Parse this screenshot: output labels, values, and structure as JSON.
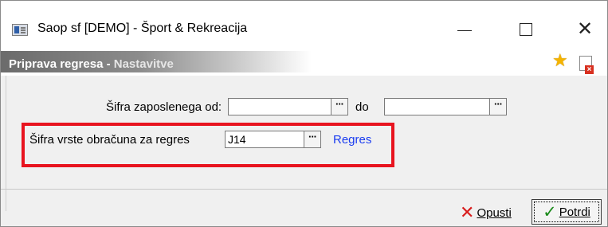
{
  "window": {
    "title": "Saop sf [DEMO] - Šport & Rekreacija",
    "minimize_icon": "minimize-icon",
    "maximize_icon": "maximize-icon",
    "close_icon": "close-icon",
    "close_glyph": "✕"
  },
  "header": {
    "title_main": "Priprava regresa - ",
    "title_sub": "Nastavitve",
    "favorite_icon": "star-icon",
    "favorite_glyph": "★",
    "doc_icon": "document-close-icon"
  },
  "form": {
    "employee_from_label": "Šifra zaposlenega od:",
    "employee_from_value": "",
    "employee_to_label": "do",
    "employee_to_value": "",
    "calc_type_label": "Šifra vrste obračuna za regres",
    "calc_type_value": "J14",
    "calc_type_description": "Regres",
    "lookup_glyph": "···"
  },
  "buttons": {
    "cancel_label": "Opusti",
    "cancel_glyph": "✕",
    "confirm_label": "Potrdi",
    "confirm_glyph": "✓"
  },
  "colors": {
    "highlight_border": "#e8141f",
    "link": "#1a3cf0",
    "star": "#f5b400"
  }
}
